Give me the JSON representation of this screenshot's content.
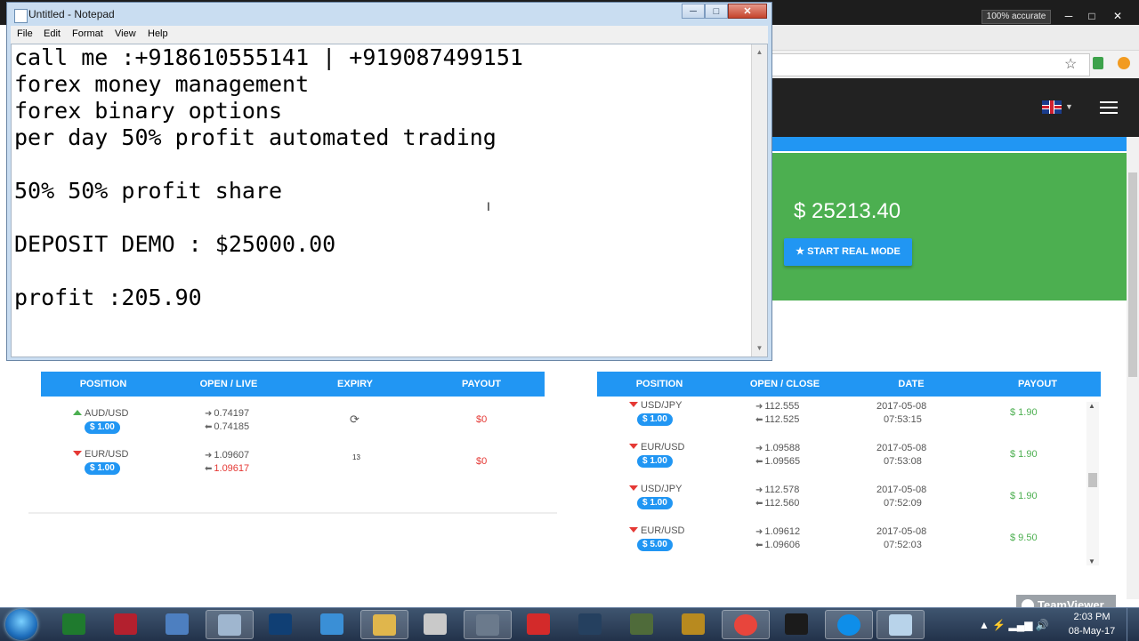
{
  "system": {
    "accuracy_badge": "100% accurate",
    "window_controls": [
      "─",
      "□",
      "✕"
    ]
  },
  "notepad": {
    "title": "Untitled - Notepad",
    "controls": [
      "─",
      "□",
      "✕"
    ],
    "menu": [
      "File",
      "Edit",
      "Format",
      "View",
      "Help"
    ],
    "content": "call me :+918610555141 | +919087499151\nforex money management\nforex binary options\nper day 50% profit automated trading\n\n50% 50% profit share\n\nDEPOSIT DEMO : $25000.00\n\nprofit :205.90"
  },
  "site": {
    "balance": "$ 25213.40",
    "start_real_label": "★ START REAL MODE",
    "open_positions": {
      "headers": [
        "POSITION",
        "OPEN / LIVE",
        "EXPIRY",
        "PAYOUT"
      ],
      "rows": [
        {
          "direction": "up",
          "pair": "AUD/USD",
          "amount": "$ 1.00",
          "open": "0.74197",
          "live": "0.74185",
          "expiry": "⟳",
          "payout": "$0"
        },
        {
          "direction": "down",
          "pair": "EUR/USD",
          "amount": "$ 1.00",
          "open": "1.09607",
          "live": "1.09617",
          "expiry": "13",
          "payout": "$0"
        }
      ]
    },
    "closed_positions": {
      "headers": [
        "POSITION",
        "OPEN / CLOSE",
        "DATE",
        "PAYOUT"
      ],
      "rows": [
        {
          "direction": "down",
          "pair": "USD/JPY",
          "amount": "$ 1.00",
          "open": "112.555",
          "close": "112.525",
          "date": "2017-05-08",
          "time": "07:53:15",
          "payout": "$ 1.90"
        },
        {
          "direction": "down",
          "pair": "EUR/USD",
          "amount": "$ 1.00",
          "open": "1.09588",
          "close": "1.09565",
          "date": "2017-05-08",
          "time": "07:53:08",
          "payout": "$ 1.90"
        },
        {
          "direction": "down",
          "pair": "USD/JPY",
          "amount": "$ 1.00",
          "open": "112.578",
          "close": "112.560",
          "date": "2017-05-08",
          "time": "07:52:09",
          "payout": "$ 1.90"
        },
        {
          "direction": "down",
          "pair": "EUR/USD",
          "amount": "$ 5.00",
          "open": "1.09612",
          "close": "1.09606",
          "date": "2017-05-08",
          "time": "07:52:03",
          "payout": "$ 9.50"
        }
      ]
    }
  },
  "teamviewer": {
    "label": "TeamViewer"
  },
  "taskbar": {
    "apps": [
      "excel-icon",
      "uk-flag-app-icon",
      "network-settings-icon",
      "calculator-icon",
      "photoshop-icon",
      "paint-icon",
      "file-explorer-icon",
      "forex-app-icon",
      "gcg-app-icon",
      "h-app-icon",
      "tower-app-icon",
      "chart-app-icon",
      "pg-app-icon",
      "chrome-icon",
      "zx-app-icon",
      "teamviewer-icon",
      "notepad-icon"
    ],
    "time": "2:03 PM",
    "date": "08-May-17"
  },
  "colors": {
    "blue": "#2196f3",
    "green": "#4caf50",
    "red": "#e53935"
  }
}
